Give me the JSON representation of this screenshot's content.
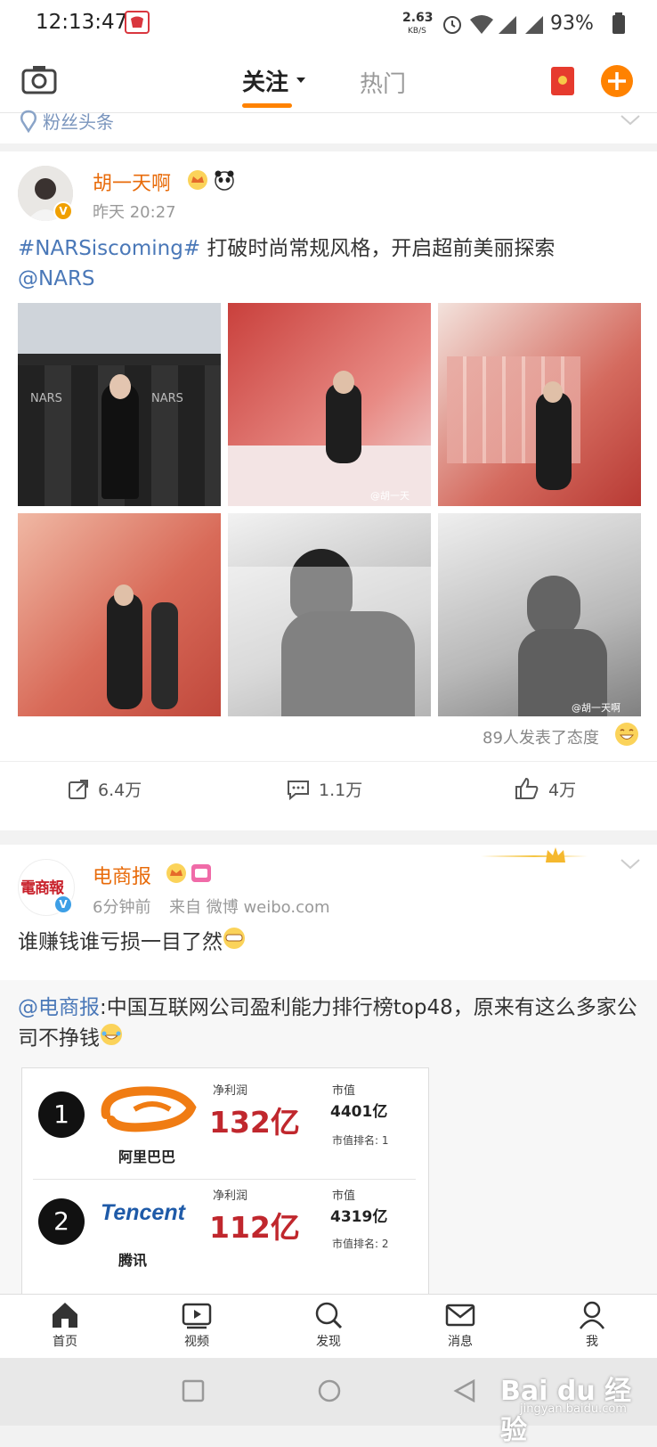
{
  "status_bar": {
    "time": "12:13:47",
    "net_speed": "2.63",
    "net_unit": "KB/S",
    "battery": "93%"
  },
  "top_nav": {
    "tab_follow": "关注",
    "tab_hot": "热门"
  },
  "section_header": {
    "label": "粉丝头条"
  },
  "post1": {
    "username": "胡一天啊",
    "time": "昨天 20:27",
    "hashtag": "#NARSiscoming#",
    "text": " 打破时尚常规风格，开启超前美丽探索",
    "mention": "@NARS",
    "photo_watermarks": [
      "@胡一天",
      "@胡一天啊"
    ],
    "reactions": "89人发表了态度",
    "repost_count": "6.4万",
    "comment_count": "1.1万",
    "like_count": "4万",
    "backdrop_logo": "NARS"
  },
  "post2": {
    "avatar_text": "電商報",
    "username": "电商报",
    "time": "6分钟前",
    "source": "来自 微博 weibo.com",
    "text": "谁赚钱谁亏损一目了然",
    "repost_mention": "@电商报",
    "repost_text": ":中国互联网公司盈利能力排行榜top48，原来有这么多家公司不挣钱",
    "ranking": [
      {
        "rank": "1",
        "logo_text": "",
        "company": "阿里巴巴",
        "profit_label": "净利润",
        "profit": "132亿",
        "cap_label": "市值",
        "cap": "4401亿",
        "rank_label": "市值排名: 1"
      },
      {
        "rank": "2",
        "logo_text": "Tencent",
        "company": "腾讯",
        "profit_label": "净利润",
        "profit": "112亿",
        "cap_label": "市值",
        "cap": "4319亿",
        "rank_label": "市值排名: 2"
      }
    ]
  },
  "bottom_nav": {
    "home": "首页",
    "video": "视频",
    "discover": "发现",
    "messages": "消息",
    "me": "我"
  },
  "watermark": {
    "text": "Bai du 经验",
    "url": "jingyan.baidu.com"
  },
  "colors": {
    "accent_orange": "#ff8200",
    "username_orange": "#e86b0a",
    "link_blue": "#4a78b8",
    "profit_red": "#c0272d"
  }
}
